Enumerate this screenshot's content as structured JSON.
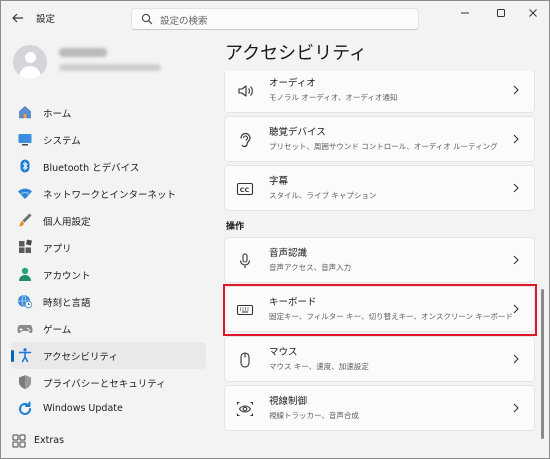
{
  "window": {
    "title": "設定",
    "controls": {
      "minimize_icon": "minimize-icon",
      "maximize_icon": "maximize-icon",
      "close_icon": "close-icon"
    }
  },
  "search": {
    "placeholder": "設定の検索",
    "icon": "search-icon"
  },
  "sidebar": {
    "items": [
      {
        "label": "ホーム",
        "icon": "home-icon",
        "active": false
      },
      {
        "label": "システム",
        "icon": "system-display-icon",
        "active": false
      },
      {
        "label": "Bluetooth とデバイス",
        "icon": "bluetooth-icon",
        "active": false
      },
      {
        "label": "ネットワークとインターネット",
        "icon": "wifi-icon",
        "active": false
      },
      {
        "label": "個人用設定",
        "icon": "paint-brush-icon",
        "active": false
      },
      {
        "label": "アプリ",
        "icon": "apps-icon",
        "active": false
      },
      {
        "label": "アカウント",
        "icon": "account-icon",
        "active": false
      },
      {
        "label": "時刻と言語",
        "icon": "globe-clock-icon",
        "active": false
      },
      {
        "label": "ゲーム",
        "icon": "gamepad-icon",
        "active": false
      },
      {
        "label": "アクセシビリティ",
        "icon": "accessibility-icon",
        "active": true
      },
      {
        "label": "プライバシーとセキュリティ",
        "icon": "shield-icon",
        "active": false
      },
      {
        "label": "Windows Update",
        "icon": "windows-update-icon",
        "active": false
      }
    ],
    "extras": {
      "label": "Extras",
      "icon": "extras-icon"
    }
  },
  "main": {
    "title": "アクセシビリティ",
    "cards_top": [
      {
        "title": "オーディオ",
        "desc": "モノラル オーディオ、オーディオ通知",
        "icon": "speaker-icon"
      },
      {
        "title": "聴覚デバイス",
        "desc": "プリセット、周囲サウンド コントロール、オーディオ ルーティング",
        "icon": "ear-icon"
      },
      {
        "title": "字幕",
        "desc": "スタイル、ライブ キャプション",
        "icon": "closed-captions-icon"
      }
    ],
    "section_label": "操作",
    "cards_interaction": [
      {
        "title": "音声認識",
        "desc": "音声アクセス、音声入力",
        "icon": "microphone-icon"
      },
      {
        "title": "キーボード",
        "desc": "固定キー、フィルター キー、切り替えキー、オンスクリーン キーボード",
        "icon": "keyboard-icon"
      },
      {
        "title": "マウス",
        "desc": "マウス キー、速度、加速設定",
        "icon": "mouse-icon"
      },
      {
        "title": "視線制御",
        "desc": "視線トラッカー、音声合成",
        "icon": "eye-control-icon"
      }
    ],
    "highlighted_card": "キーボード"
  },
  "colors": {
    "accent": "#0067c0",
    "highlight_border": "#e0172a",
    "window_bg": "#f3f3f3",
    "card_bg": "#fbfbfb"
  }
}
